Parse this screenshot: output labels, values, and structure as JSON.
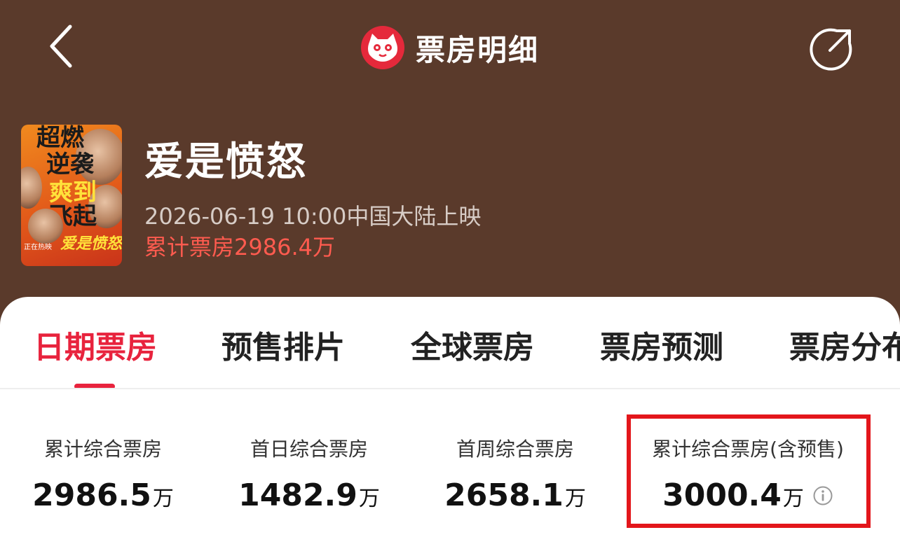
{
  "header": {
    "title": "票房明细",
    "back_icon": "chevron-left-icon",
    "share_icon": "share-icon",
    "logo_icon": "cat-logo-icon",
    "bg_color": "#5a3a2b"
  },
  "movie": {
    "name": "爱是愤怒",
    "release": "2026-06-19 10:00中国大陆上映",
    "cumulative_box_office": "累计票房2986.4万",
    "poster": {
      "lines": [
        "超燃",
        "逆袭",
        "爽到",
        "飞起"
      ],
      "logo_text": "爱是愤怒",
      "small_text": "正在热映"
    }
  },
  "tabs": [
    {
      "label": "日期票房",
      "active": true
    },
    {
      "label": "预售排片",
      "active": false
    },
    {
      "label": "全球票房",
      "active": false
    },
    {
      "label": "票房预测",
      "active": false
    },
    {
      "label": "票房分布",
      "active": false
    }
  ],
  "stats": [
    {
      "label": "累计综合票房",
      "value": "2986.5",
      "unit": "万"
    },
    {
      "label": "首日综合票房",
      "value": "1482.9",
      "unit": "万"
    },
    {
      "label": "首周综合票房",
      "value": "2658.1",
      "unit": "万"
    },
    {
      "label": "累计综合票房(含预售)",
      "value": "3000.4",
      "unit": "万",
      "info_icon": "info-icon"
    }
  ],
  "colors": {
    "accent": "#e8233d",
    "highlight_border": "#e3161b",
    "box_office_text": "#ff5b4f"
  }
}
